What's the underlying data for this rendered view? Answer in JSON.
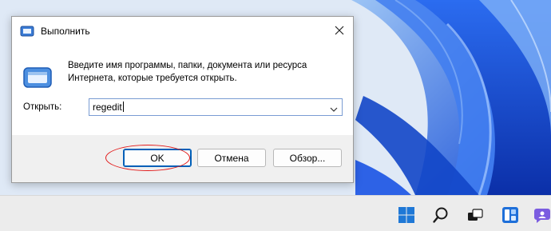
{
  "dialog": {
    "title": "Выполнить",
    "description": "Введите имя программы, папки, документа или ресурса Интернета, которые требуется открыть.",
    "open_label": "Открыть:",
    "input_value": "regedit",
    "buttons": {
      "ok": "OK",
      "cancel": "Отмена",
      "browse": "Обзор..."
    },
    "icons": {
      "title": "run-app-icon",
      "large": "run-app-icon",
      "close": "close-icon",
      "dropdown": "chevron-down-icon"
    }
  },
  "taskbar": {
    "icons": [
      "windows-start-icon",
      "search-icon",
      "task-view-icon",
      "widgets-icon",
      "chat-icon"
    ]
  },
  "colors": {
    "highlight_ellipse": "#e21b1b",
    "accent": "#005fb8",
    "wallpaper_blue": "#1e5fe0"
  }
}
